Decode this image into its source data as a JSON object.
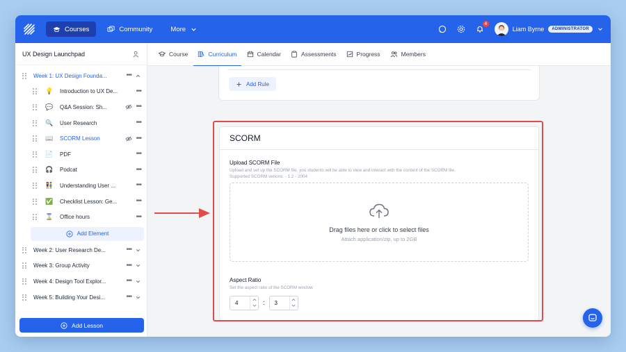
{
  "topbar": {
    "nav": [
      {
        "label": "Courses",
        "icon": "graduation-cap-icon",
        "active": true
      },
      {
        "label": "Community",
        "icon": "community-icon",
        "active": false
      },
      {
        "label": "More",
        "icon": "chevron-down-icon",
        "active": false
      }
    ],
    "notifications_count": "4",
    "user_name": "Liam Byrne",
    "user_role": "ADMINISTRATOR"
  },
  "sidebar": {
    "course_title": "UX Design Launchpad",
    "weeks": [
      {
        "label": "Week 1: UX Design Founda...",
        "expanded": true,
        "children": [
          {
            "emoji": "💡",
            "label": "Introduction to UX De...",
            "hidden": false,
            "active": false
          },
          {
            "emoji": "💬",
            "label": "Q&A Session: Sh...",
            "hidden": true,
            "active": false
          },
          {
            "emoji": "🔍",
            "label": "User Research",
            "hidden": false,
            "active": false
          },
          {
            "emoji": "📖",
            "label": "SCORM Lesson",
            "hidden": true,
            "active": true
          },
          {
            "emoji": "📄",
            "label": "PDF",
            "hidden": false,
            "active": false
          },
          {
            "emoji": "🎧",
            "label": "Podcat",
            "hidden": false,
            "active": false
          },
          {
            "emoji": "👫",
            "label": "Understanding User ...",
            "hidden": false,
            "active": false
          },
          {
            "emoji": "✅",
            "label": "Checklist Lesson: Ge...",
            "hidden": false,
            "active": false
          },
          {
            "emoji": "⌛",
            "label": "Office hours",
            "hidden": false,
            "active": false
          }
        ]
      },
      {
        "label": "Week 2: User Research De...",
        "expanded": false
      },
      {
        "label": "Week 3: Group Activity",
        "expanded": false
      },
      {
        "label": "Week 4: Design Tool Explor...",
        "expanded": false
      },
      {
        "label": "Week 5: Building Your Desi...",
        "expanded": false
      }
    ],
    "add_element_label": "Add Element",
    "add_lesson_label": "Add Lesson"
  },
  "tabs": [
    {
      "label": "Course",
      "icon": "graduation-cap-icon",
      "active": false
    },
    {
      "label": "Curriculum",
      "icon": "curriculum-icon",
      "active": true
    },
    {
      "label": "Calendar",
      "icon": "calendar-icon",
      "active": false
    },
    {
      "label": "Assessments",
      "icon": "clipboard-icon",
      "active": false
    },
    {
      "label": "Progress",
      "icon": "progress-icon",
      "active": false
    },
    {
      "label": "Members",
      "icon": "members-icon",
      "active": false
    }
  ],
  "main": {
    "add_rule_label": "Add Rule",
    "scorm": {
      "title": "SCORM",
      "upload_label": "Upload SCORM File",
      "upload_help": "Upload and set up the SCORM file. you students will be able to view and interact with the content of the SCORM file.",
      "supported_versions": "Supported SCORM verions: - 1.2 - 2004",
      "dropzone_text": "Drag files here or click to select files",
      "dropzone_sub": "Attach application/zip, up to 2GB",
      "aspect_label": "Aspect Ratio",
      "aspect_help": "Set the aspect ratio of the SCORM window",
      "ratio_width": "4",
      "ratio_height": "3",
      "ratio_separator": ":"
    }
  },
  "colors": {
    "primary": "#2563eb",
    "highlight": "#e34b4b",
    "background": "#a9cdf0"
  }
}
